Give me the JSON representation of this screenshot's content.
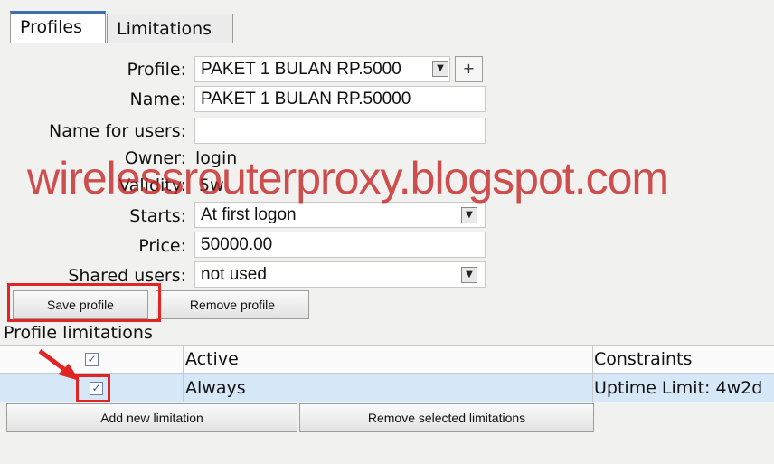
{
  "tabs": [
    {
      "label": "Profiles",
      "active": true
    },
    {
      "label": "Limitations",
      "active": false
    }
  ],
  "form": {
    "profile_label": "Profile:",
    "profile_value": "PAKET 1 BULAN RP.5000",
    "add_symbol": "+",
    "name_label": "Name:",
    "name_value": "PAKET 1 BULAN RP.50000",
    "name_for_users_label": "Name for users:",
    "name_for_users_value": "",
    "owner_label": "Owner:",
    "owner_value": "login",
    "validity_label": "Validity:",
    "validity_value": "5w",
    "starts_label": "Starts:",
    "starts_value": "At first logon",
    "price_label": "Price:",
    "price_value": "50000.00",
    "shared_users_label": "Shared users:",
    "shared_users_value": "not used"
  },
  "buttons": {
    "save_profile": "Save profile",
    "remove_profile": "Remove profile",
    "add_limitation": "Add new limitation",
    "remove_limitations": "Remove selected limitations"
  },
  "limitations": {
    "section_title": "Profile limitations",
    "header": {
      "active": "Active",
      "constraints": "Constraints",
      "checked": true
    },
    "rows": [
      {
        "active": "Always",
        "constraints": "Uptime Limit: 4w2d",
        "checked": true
      }
    ]
  },
  "watermark": "wirelessrouterproxy.blogspot.com",
  "icons": {
    "dropdown": "chevron-down-icon",
    "check": "checkmark-icon"
  },
  "colors": {
    "accent_tab": "#3a6fb0",
    "highlight_red": "#e12424",
    "selected_row": "#d6e8f7",
    "watermark": "#c42a2a"
  }
}
